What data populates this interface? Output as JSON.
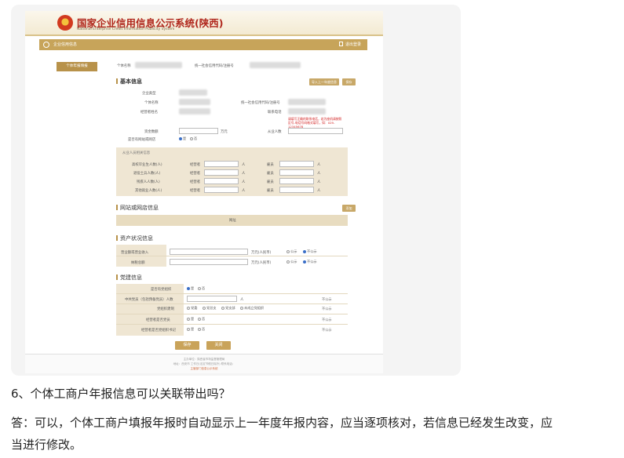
{
  "header": {
    "site_title": "国家企业信用信息公示系统(陕西)",
    "site_subtitle": "National Enterprise Credit Information Publicity System"
  },
  "navbar": {
    "left_text": "企业信用信息",
    "right_text": "退出登录"
  },
  "sidebar": {
    "active_item": "个体年报填报"
  },
  "form": {
    "top": {
      "name_label": "个体名称",
      "code_label": "统一社会信用代码/注册号"
    },
    "basic": {
      "title": "基本信息",
      "buttons": [
        "导入上一年度信息",
        "保存"
      ],
      "rows": [
        {
          "label": "企业类型"
        },
        {
          "label": "个体名称",
          "right_label": "统一社会信用代码/注册号"
        },
        {
          "label": "经营者姓名",
          "right_label": "联系电话"
        },
        {
          "label": "资金数额",
          "unit": "万元",
          "right_label": "从业人数"
        },
        {
          "label": "是否有网站或网店"
        }
      ],
      "yes": "是",
      "no": "否",
      "warning": "请填写正确的联系电话，若为座机请按照区号-电话号码格式填写，如：029-12345678"
    },
    "employment": {
      "title": "从业人员相关信息",
      "rows": [
        {
          "label": "高校毕业生人数(人)",
          "a": "经营者",
          "b": "雇员"
        },
        {
          "label": "退役士兵人数(人)",
          "a": "经营者",
          "b": "雇员"
        },
        {
          "label": "残疾人人数(人)",
          "a": "经营者",
          "b": "雇员"
        },
        {
          "label": "其他就业人数(人)",
          "a": "经营者",
          "b": "雇员"
        }
      ],
      "unit": "人"
    },
    "website": {
      "title": "网站或网店信息",
      "add_button": "添加",
      "table_header": "网址"
    },
    "assets": {
      "title": "资产状况信息",
      "rows": [
        {
          "label": "营业额或营业收入",
          "unit": "万元(人民币)"
        },
        {
          "label": "纳税总额",
          "unit": "万元(人民币)"
        }
      ],
      "public": "公示",
      "nonpublic": "不公示"
    },
    "party": {
      "title": "党建信息",
      "rows": [
        {
          "label": "是否有党组织",
          "opts": [
            "是",
            "否"
          ],
          "tag": ""
        },
        {
          "label": "中共党员（包括预备党员）人数",
          "unit": "人",
          "tag": "不公示"
        },
        {
          "label": "党组织建制",
          "opts": [
            "党委",
            "党总支",
            "党支部",
            "未成立党组织"
          ],
          "tag": "不公示"
        },
        {
          "label": "经营者是否党员",
          "opts": [
            "是",
            "否"
          ],
          "tag": "不公示"
        },
        {
          "label": "经营者是否党组织书记",
          "opts": [
            "是",
            "否"
          ],
          "tag": "不公示"
        }
      ]
    },
    "actions": [
      "保存",
      "关闭"
    ]
  },
  "footer": {
    "line1": "主办单位：陕西省市场监督管理局",
    "line2": "地址：西安市 工作日(法定节假日除外) 联系电话：",
    "line3": "主管部门信息公示系统"
  },
  "article": {
    "question": "6、个体工商户年报信息可以关联带出吗？",
    "answer": "答：可以，个体工商户填报年报时自动显示上一年度年报内容，应当逐项核对，若信息已经发生改变，应当进行修改。"
  }
}
